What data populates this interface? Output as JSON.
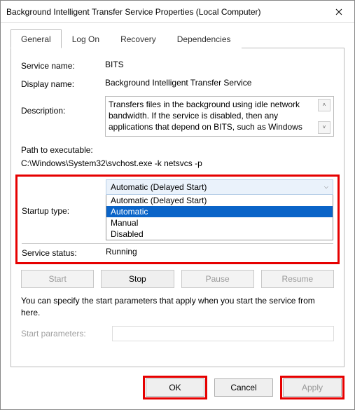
{
  "window": {
    "title": "Background Intelligent Transfer Service Properties (Local Computer)"
  },
  "tabs": {
    "general": "General",
    "logon": "Log On",
    "recovery": "Recovery",
    "dependencies": "Dependencies"
  },
  "general": {
    "service_name_label": "Service name:",
    "service_name_value": "BITS",
    "display_name_label": "Display name:",
    "display_name_value": "Background Intelligent Transfer Service",
    "description_label": "Description:",
    "description_value": "Transfers files in the background using idle network bandwidth. If the service is disabled, then any applications that depend on BITS, such as Windows",
    "path_label": "Path to executable:",
    "path_value": "C:\\Windows\\System32\\svchost.exe -k netsvcs -p",
    "startup_type_label": "Startup type:",
    "startup_type_value": "Automatic (Delayed Start)",
    "startup_options": {
      "opt0": "Automatic (Delayed Start)",
      "opt1": "Automatic",
      "opt2": "Manual",
      "opt3": "Disabled"
    },
    "service_status_label": "Service status:",
    "service_status_value": "Running",
    "buttons": {
      "start": "Start",
      "stop": "Stop",
      "pause": "Pause",
      "resume": "Resume"
    },
    "note": "You can specify the start parameters that apply when you start the service from here.",
    "start_params_label": "Start parameters:",
    "start_params_value": ""
  },
  "footer": {
    "ok": "OK",
    "cancel": "Cancel",
    "apply": "Apply"
  }
}
